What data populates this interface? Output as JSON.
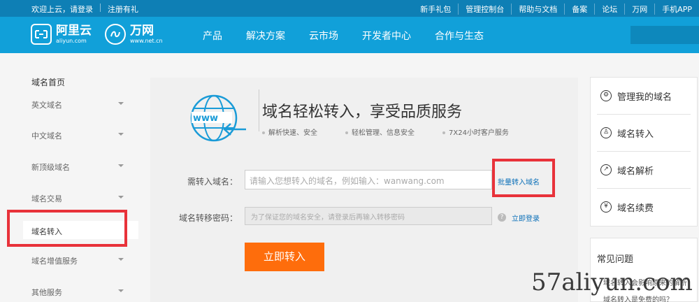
{
  "topbar": {
    "welcome": "欢迎上云，请登录",
    "register": "注册有礼",
    "links": [
      "新手礼包",
      "管理控制台",
      "帮助与文档",
      "备案",
      "论坛",
      "万网",
      "手机APP"
    ]
  },
  "header": {
    "aliyun_logo": {
      "name": "阿里云",
      "sub": "aliyun.com"
    },
    "wanwang_logo": {
      "name": "万网",
      "sub": "www.net.cn"
    },
    "nav": [
      "产品",
      "解决方案",
      "云市场",
      "开发者中心",
      "合作与生态"
    ]
  },
  "sidebar": {
    "home": "域名首页",
    "items": [
      "英文域名",
      "中文域名",
      "新顶级域名",
      "域名交易",
      "域名转入",
      "域名增值服务",
      "其他服务"
    ],
    "active_index": 4
  },
  "main": {
    "globe_text": "www",
    "headline": "域名轻松转入，享受品质服务",
    "bullets": [
      "解析快速、安全",
      "轻松管理、信息安全",
      "7X24小时客户服务"
    ],
    "domain_label": "需转入域名：",
    "domain_placeholder": "请输入您想转入的域名，例如输入：wanwang.com",
    "batch_link": "批量转入域名",
    "password_label": "域名转移密码：",
    "password_placeholder": "为了保证您的域名安全，请登录后再输入转移密码",
    "login_link": "立即登录",
    "submit": "立即转入"
  },
  "right_panel": {
    "items": [
      {
        "label": "管理我的域名",
        "icon": "gear-icon",
        "glyph": "⚙"
      },
      {
        "label": "域名转入",
        "icon": "user-icon",
        "glyph": "♙"
      },
      {
        "label": "域名解析",
        "icon": "chart-icon",
        "glyph": "↗"
      },
      {
        "label": "域名续费",
        "icon": "yen-icon",
        "glyph": "¥"
      }
    ]
  },
  "faq": {
    "title": "常见问题",
    "questions": [
      "域名转入会影响原来的解析吗？",
      "域名转入是免费的吗？"
    ]
  },
  "watermark": "57aliyun.com",
  "colors": {
    "topbar": "#0e7fb5",
    "navbar": "#11a0d9",
    "submit": "#fe6d0c",
    "highlight_box": "#e8323a",
    "link": "#0a6fb8"
  }
}
